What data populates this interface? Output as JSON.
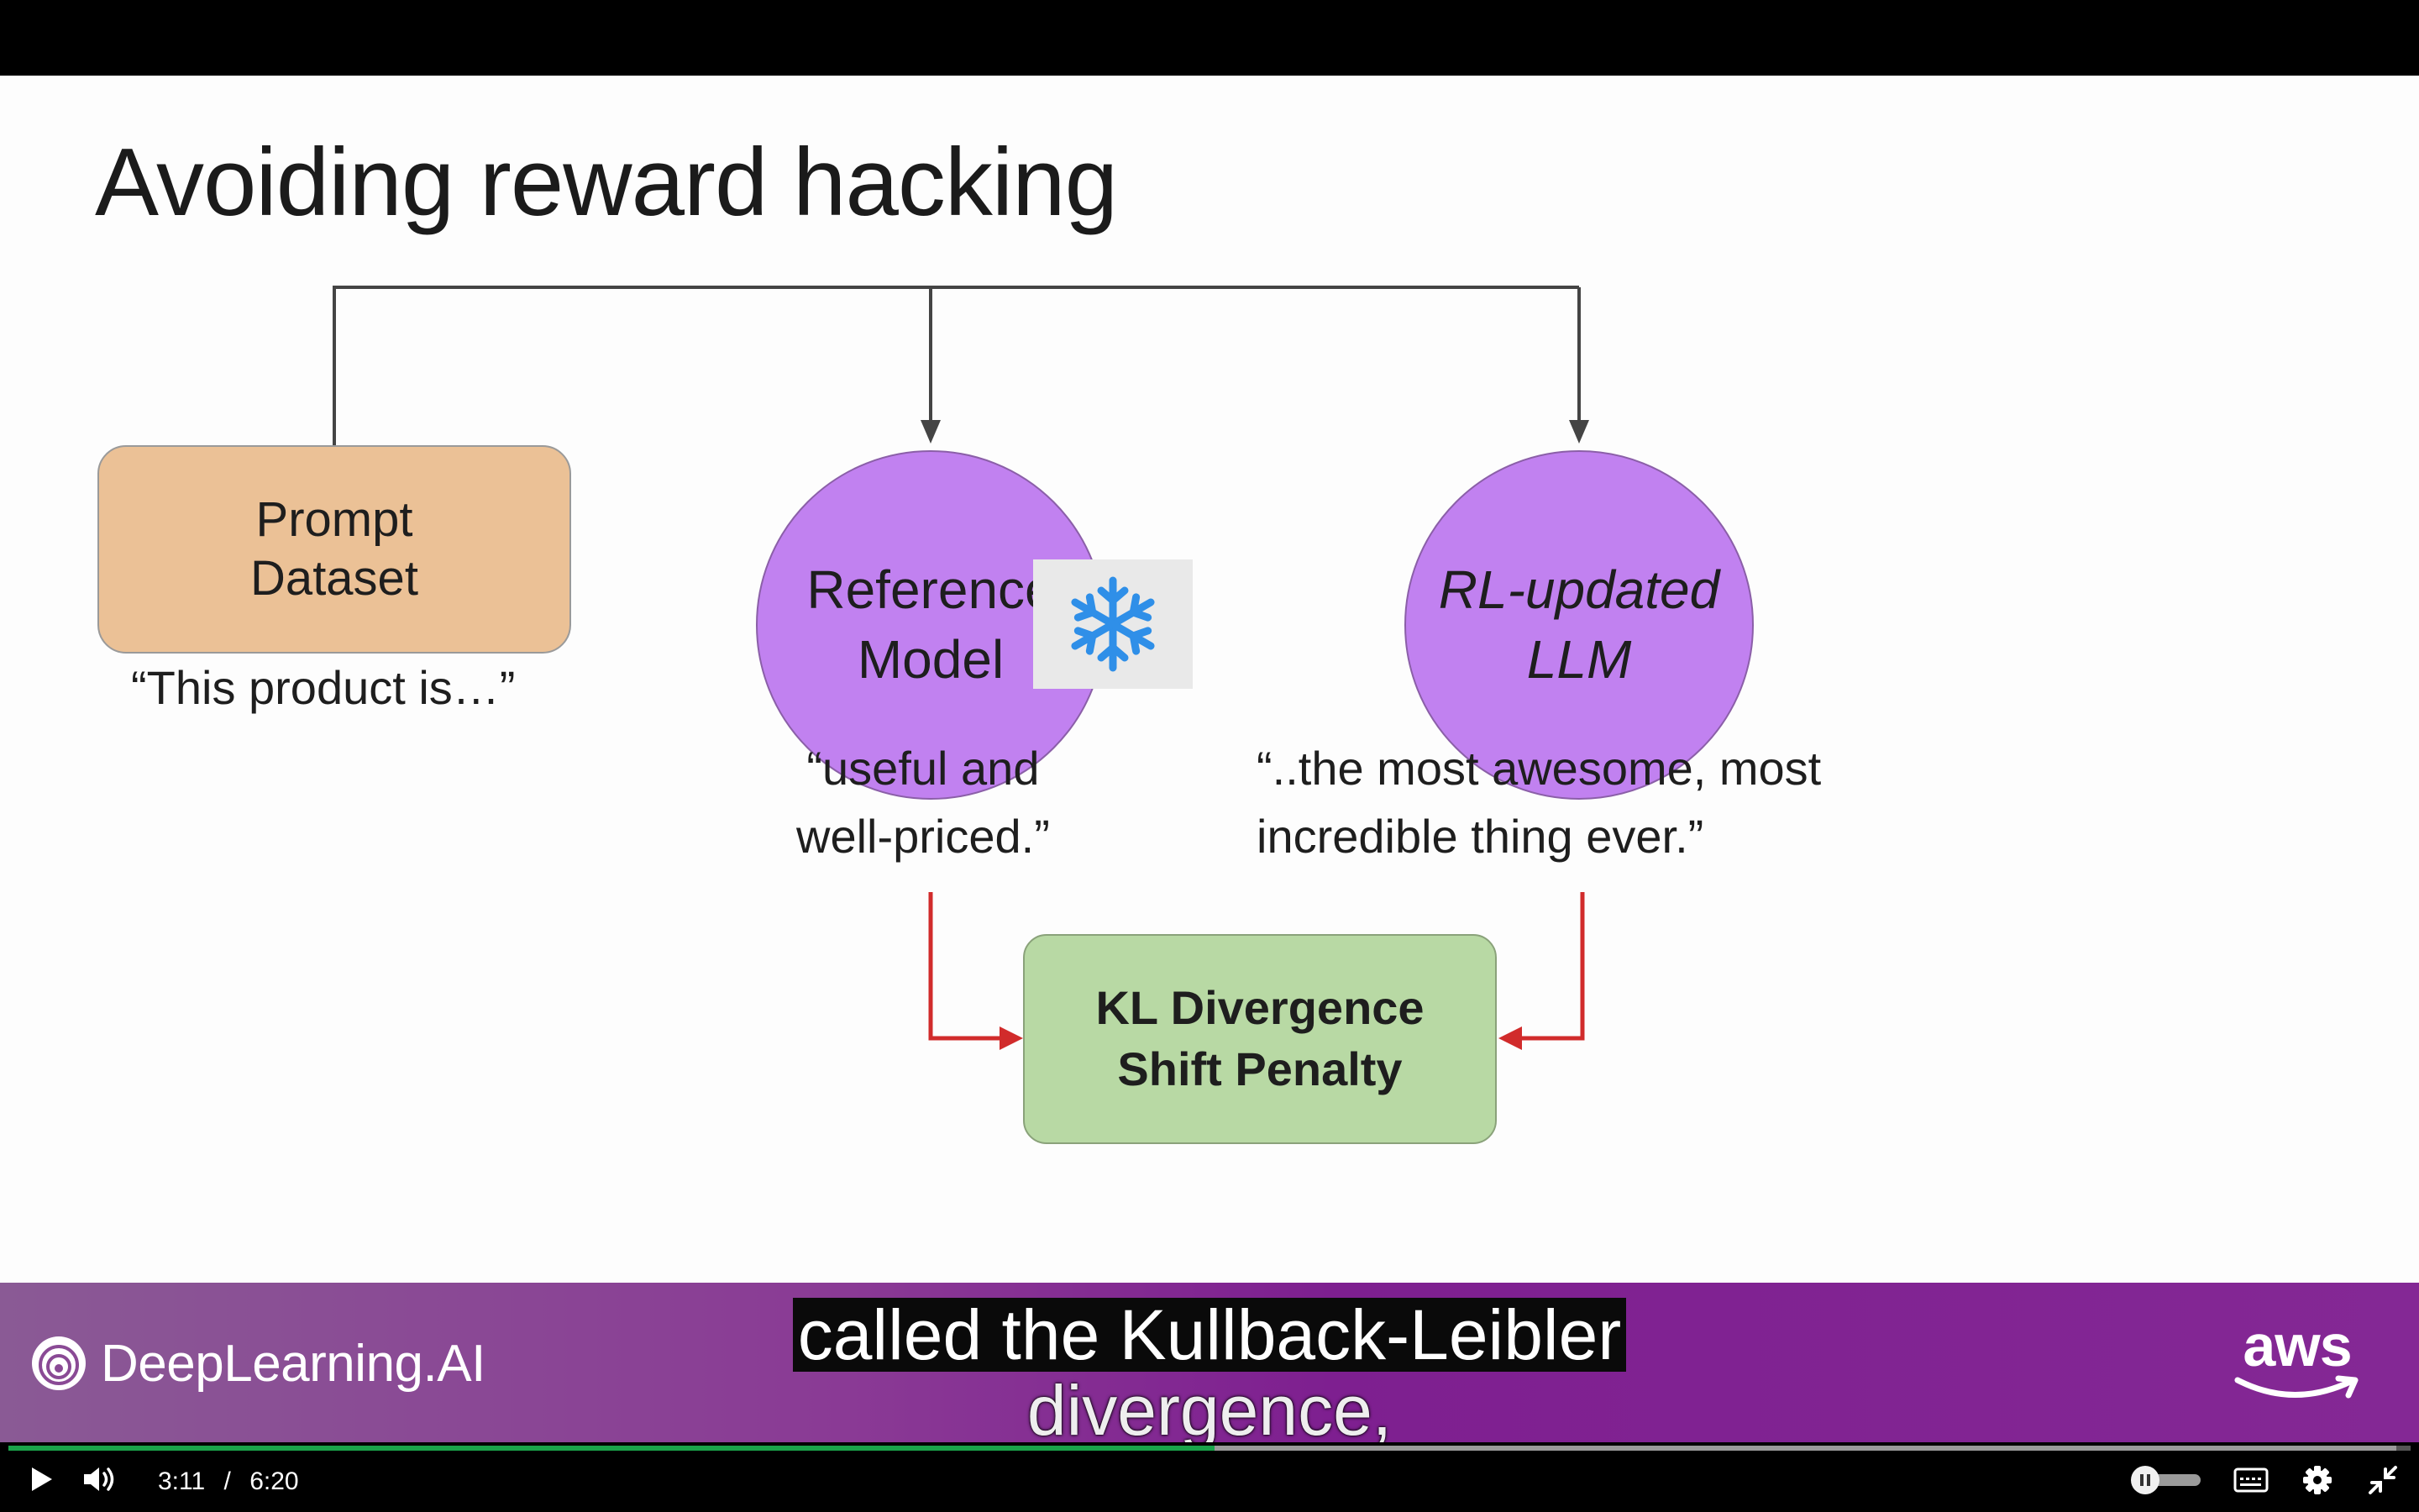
{
  "slide": {
    "title": "Avoiding reward hacking",
    "prompt_box": {
      "line1": "Prompt",
      "line2": "Dataset"
    },
    "prompt_quote": "“This product  is…”",
    "reference_model": {
      "line1": "Reference",
      "line2": "Model"
    },
    "reference_quote": {
      "line1": "“useful and",
      "line2": "well-priced.”"
    },
    "rl_model": {
      "line1": "RL-updated",
      "line2": "LLM"
    },
    "rl_quote": {
      "line1": "“..the most awesome, most",
      "line2": "incredible thing ever.”"
    },
    "kl_box": {
      "line1": "KL Divergence",
      "line2": "Shift Penalty"
    },
    "freeze_icon": "snowflake-icon"
  },
  "banner": {
    "brand": "DeepLearning.AI",
    "partner": "aws",
    "colors": {
      "left": "#8a5a95",
      "right": "#842895"
    }
  },
  "caption": {
    "line1": "called the Kullback-Leibler",
    "line2": "divergence,"
  },
  "player": {
    "current_time": "3:11",
    "separator": "/",
    "duration": "6:20",
    "progress_fraction": 0.502,
    "buffered_fraction": 0.994,
    "accent_color": "#1aa34a",
    "icons": [
      "play-icon",
      "volume-icon",
      "autoplay-toggle",
      "captions-icon",
      "settings-icon",
      "exit-fullscreen-icon"
    ]
  }
}
